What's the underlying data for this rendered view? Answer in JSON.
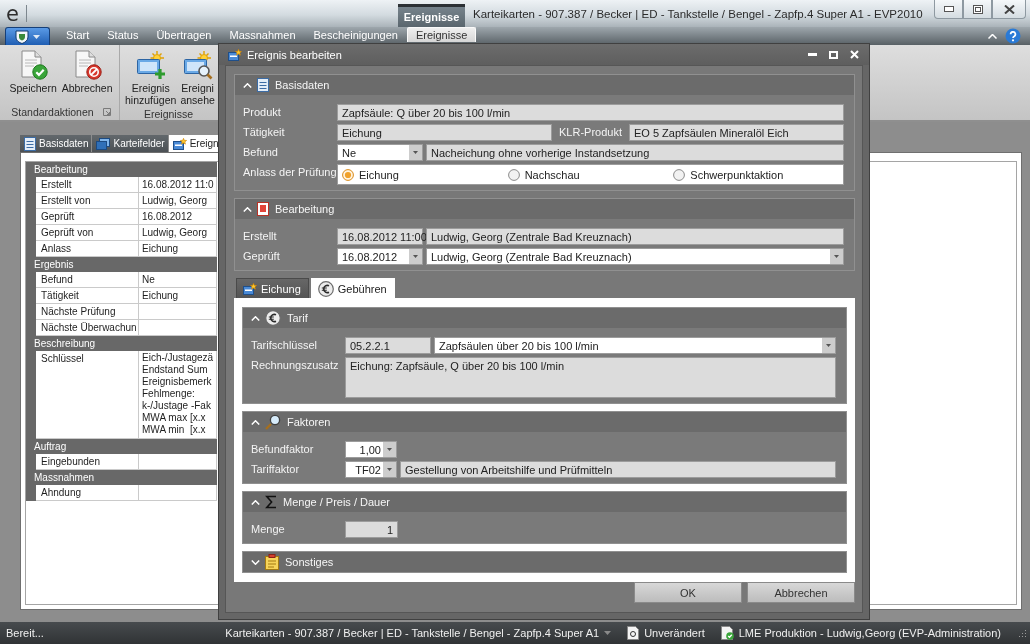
{
  "window": {
    "logo": "e",
    "context_group": "Ereignisse",
    "title": "Karteikarten - 907.387 / Becker | ED - Tankstelle / Bengel - Zapfp.4 Super A1 - EVP2010"
  },
  "ribbon": {
    "tabs": [
      {
        "label": "Start",
        "selected": false
      },
      {
        "label": "Status",
        "selected": false
      },
      {
        "label": "Übertragen",
        "selected": false
      },
      {
        "label": "Massnahmen",
        "selected": false
      },
      {
        "label": "Bescheinigungen",
        "selected": false
      },
      {
        "label": "Ereignisse",
        "selected": true
      }
    ],
    "groups": [
      {
        "label": "Standardaktionen",
        "launcher": true,
        "buttons": [
          {
            "label": "Speichern"
          },
          {
            "label": "Abbrechen"
          }
        ]
      },
      {
        "label": "Ereignisse",
        "buttons": [
          {
            "label": "Ereignis hinzufügen"
          },
          {
            "label": "Ereigni ansehe"
          }
        ]
      }
    ]
  },
  "detail_tabs": [
    {
      "label": "Basisdaten",
      "selected": false
    },
    {
      "label": "Karteifelder",
      "selected": false
    },
    {
      "label": "Ereign",
      "selected": true
    }
  ],
  "property_grid": [
    {
      "category": "Bearbeitung",
      "rows": [
        {
          "label": "Erstellt",
          "value": "16.08.2012 11:0"
        },
        {
          "label": "Erstellt von",
          "value": "Ludwig, Georg"
        },
        {
          "label": "Geprüft",
          "value": "16.08.2012"
        },
        {
          "label": "Geprüft von",
          "value": "Ludwig, Georg"
        },
        {
          "label": "Anlass",
          "value": "Eichung"
        }
      ]
    },
    {
      "category": "Ergebnis",
      "rows": [
        {
          "label": "Befund",
          "value": "Ne"
        },
        {
          "label": "Tätigkeit",
          "value": "Eichung"
        },
        {
          "label": "Nächste Prüfung"
        },
        {
          "label": "Nächste Überwachun"
        }
      ]
    },
    {
      "category": "Beschreibung",
      "rows": [
        {
          "label": "Schlüssel",
          "value": "Eich-/Justagezä\nEndstand Sum\nEreignisbemerk\nFehlmenge:\nk-/Justage -Fak\nMWA max [x.x\nMWA min  [x.x"
        }
      ]
    },
    {
      "category": "Auftrag",
      "rows": [
        {
          "label": "Eingebunden"
        }
      ]
    },
    {
      "category": "Massnahmen",
      "rows": [
        {
          "label": "Ahndung"
        }
      ]
    }
  ],
  "dialog": {
    "title": "Ereignis bearbeiten",
    "sections": [
      {
        "title": "Basisdaten",
        "expanded": true,
        "rows": [
          {
            "label": "Produkt",
            "fields": [
              {
                "kind": "text",
                "value": "Zapfsäule: Q über 20 bis 100 l/min"
              }
            ]
          },
          {
            "label": "Tätigkeit",
            "fields": [
              {
                "kind": "text",
                "value": "Eichung"
              },
              {
                "kind": "caption",
                "text": "KLR-Produkt"
              },
              {
                "kind": "text",
                "value": "EO 5 Zapfsäulen Mineralöl Eich"
              }
            ]
          },
          {
            "label": "Befund",
            "fields": [
              {
                "kind": "code_dropdown",
                "value": "Ne"
              },
              {
                "kind": "text",
                "value": "Nacheichung ohne vorherige Instandsetzung"
              }
            ]
          },
          {
            "label": "Anlass der Prüfung",
            "fields": [
              {
                "kind": "radios",
                "options": [
                  {
                    "label": "Eichung",
                    "selected": true
                  },
                  {
                    "label": "Nachschau",
                    "selected": false
                  },
                  {
                    "label": "Schwerpunktaktion",
                    "selected": false
                  }
                ]
              }
            ]
          }
        ]
      },
      {
        "title": "Bearbeitung",
        "expanded": true,
        "rows": [
          {
            "label": "Erstellt",
            "fields": [
              {
                "kind": "code",
                "value": "16.08.2012 11:00"
              },
              {
                "kind": "text",
                "value": "Ludwig, Georg (Zentrale Bad Kreuznach)"
              }
            ]
          },
          {
            "label": "Geprüft",
            "fields": [
              {
                "kind": "code_dropdown",
                "value": "16.08.2012"
              },
              {
                "kind": "dropdown",
                "value": "Ludwig, Georg (Zentrale Bad Kreuznach)"
              }
            ]
          }
        ]
      }
    ],
    "tabs": [
      {
        "label": "Eichung",
        "selected": false
      },
      {
        "label": "Gebühren",
        "selected": true
      }
    ],
    "tab_sections": [
      {
        "title": "Tarif",
        "expanded": true,
        "rows": [
          {
            "label": "Tarifschlüssel",
            "fields": [
              {
                "kind": "code",
                "value": "05.2.2.1"
              },
              {
                "kind": "dropdown",
                "value": "Zapfsäulen über 20 bis 100 l/min"
              }
            ]
          },
          {
            "label": "Rechnungszusatz",
            "fields": [
              {
                "kind": "memo",
                "value": "Eichung: Zapfsäule, Q über 20 bis 100 l/min"
              }
            ]
          }
        ]
      },
      {
        "title": "Faktoren",
        "expanded": true,
        "rows": [
          {
            "label": "Befundfaktor",
            "fields": [
              {
                "kind": "number_dropdown",
                "value": "1,00"
              }
            ]
          },
          {
            "label": "Tariffaktor",
            "fields": [
              {
                "kind": "number_dropdown",
                "value": "TF02"
              },
              {
                "kind": "text",
                "value": "Gestellung von Arbeitshilfe und Prüfmitteln"
              }
            ]
          }
        ]
      },
      {
        "title": "Menge / Preis / Dauer",
        "expanded": true,
        "rows": [
          {
            "label": "Menge",
            "fields": [
              {
                "kind": "number",
                "value": "1"
              }
            ]
          }
        ]
      },
      {
        "title": "Sonstiges",
        "expanded": false
      }
    ],
    "buttons": [
      {
        "label": "OK"
      },
      {
        "label": "Abbrechen"
      }
    ]
  },
  "status_bar": {
    "message": "Bereit...",
    "context": "Karteikarten - 907.387 / Becker | ED - Tankstelle / Bengel - Zapfp.4 Super A1",
    "document_state": "Unverändert",
    "session": "LME Produktion - Ludwig,Georg (EVP-Administration)"
  }
}
